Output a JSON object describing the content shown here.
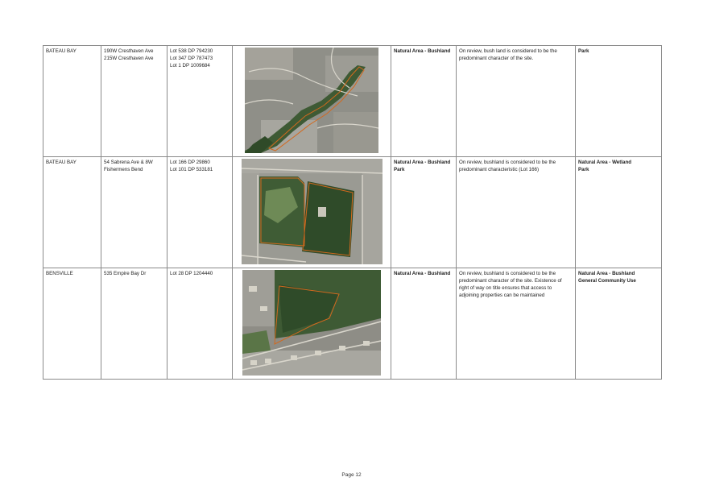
{
  "rows": [
    {
      "suburb": "BATEAU BAY",
      "address": [
        "190W Cresthaven Ave",
        "215W Cresthaven Ave"
      ],
      "lots": [
        "Lot 538 DP 794230",
        "Lot 347 DP 787473",
        "Lot 1 DP 1009684"
      ],
      "current": [
        "Natural Area - Bushland"
      ],
      "comment": "On review, bush land is considered to be the predominant character of the site.",
      "proposed": [
        "Park"
      ]
    },
    {
      "suburb": "BATEAU BAY",
      "address": [
        "54 Sabrena Ave & 8W",
        "Fishermens Bend"
      ],
      "lots": [
        "Lot 166 DP 29860",
        "Lot 101 DP 533181"
      ],
      "current": [
        "Natural Area - Bushland",
        "Park"
      ],
      "comment": "On review, bushland is considered to be the predominant characteristic (Lot 166)",
      "proposed": [
        "Natural Area - Wetland",
        "Park"
      ]
    },
    {
      "suburb": "BENSVILLE",
      "address": [
        "535 Empire Bay Dr"
      ],
      "lots": [
        "Lot 28 DP 1204440"
      ],
      "current": [
        "Natural Area - Bushland"
      ],
      "comment": "On review, bushland is considered to be the predominant character of the site. Existence of right of way on title ensures that access to adjoining properties can be maintained",
      "proposed": [
        "Natural Area - Bushland",
        "General Community Use"
      ]
    }
  ],
  "colors": {
    "border": "#8a8a8a",
    "boundary": "#d2691e"
  },
  "footer": {
    "page": "Page 12"
  }
}
